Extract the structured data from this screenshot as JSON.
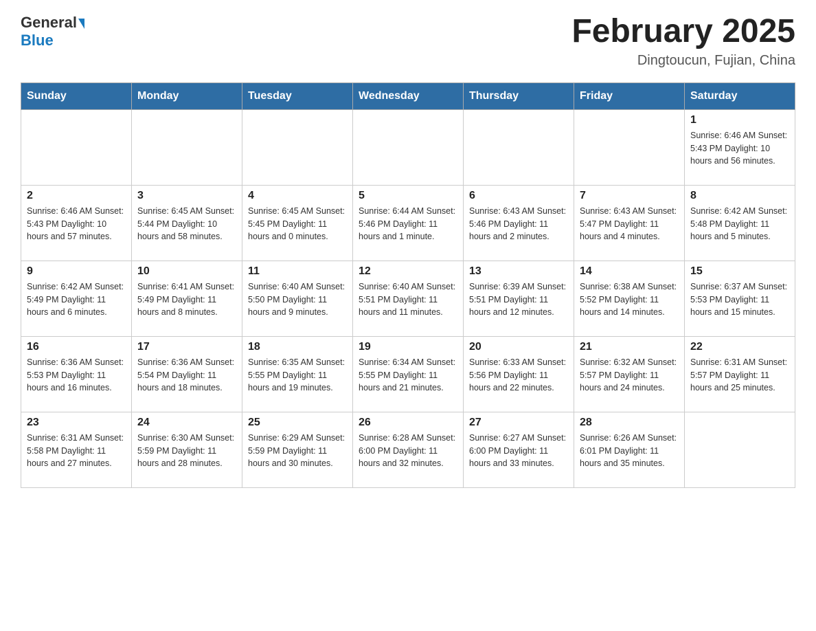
{
  "header": {
    "logo_general": "General",
    "logo_blue": "Blue",
    "month_title": "February 2025",
    "location": "Dingtoucun, Fujian, China"
  },
  "weekdays": [
    "Sunday",
    "Monday",
    "Tuesday",
    "Wednesday",
    "Thursday",
    "Friday",
    "Saturday"
  ],
  "weeks": [
    {
      "days": [
        {
          "number": "",
          "info": ""
        },
        {
          "number": "",
          "info": ""
        },
        {
          "number": "",
          "info": ""
        },
        {
          "number": "",
          "info": ""
        },
        {
          "number": "",
          "info": ""
        },
        {
          "number": "",
          "info": ""
        },
        {
          "number": "1",
          "info": "Sunrise: 6:46 AM\nSunset: 5:43 PM\nDaylight: 10 hours\nand 56 minutes."
        }
      ]
    },
    {
      "days": [
        {
          "number": "2",
          "info": "Sunrise: 6:46 AM\nSunset: 5:43 PM\nDaylight: 10 hours\nand 57 minutes."
        },
        {
          "number": "3",
          "info": "Sunrise: 6:45 AM\nSunset: 5:44 PM\nDaylight: 10 hours\nand 58 minutes."
        },
        {
          "number": "4",
          "info": "Sunrise: 6:45 AM\nSunset: 5:45 PM\nDaylight: 11 hours\nand 0 minutes."
        },
        {
          "number": "5",
          "info": "Sunrise: 6:44 AM\nSunset: 5:46 PM\nDaylight: 11 hours\nand 1 minute."
        },
        {
          "number": "6",
          "info": "Sunrise: 6:43 AM\nSunset: 5:46 PM\nDaylight: 11 hours\nand 2 minutes."
        },
        {
          "number": "7",
          "info": "Sunrise: 6:43 AM\nSunset: 5:47 PM\nDaylight: 11 hours\nand 4 minutes."
        },
        {
          "number": "8",
          "info": "Sunrise: 6:42 AM\nSunset: 5:48 PM\nDaylight: 11 hours\nand 5 minutes."
        }
      ]
    },
    {
      "days": [
        {
          "number": "9",
          "info": "Sunrise: 6:42 AM\nSunset: 5:49 PM\nDaylight: 11 hours\nand 6 minutes."
        },
        {
          "number": "10",
          "info": "Sunrise: 6:41 AM\nSunset: 5:49 PM\nDaylight: 11 hours\nand 8 minutes."
        },
        {
          "number": "11",
          "info": "Sunrise: 6:40 AM\nSunset: 5:50 PM\nDaylight: 11 hours\nand 9 minutes."
        },
        {
          "number": "12",
          "info": "Sunrise: 6:40 AM\nSunset: 5:51 PM\nDaylight: 11 hours\nand 11 minutes."
        },
        {
          "number": "13",
          "info": "Sunrise: 6:39 AM\nSunset: 5:51 PM\nDaylight: 11 hours\nand 12 minutes."
        },
        {
          "number": "14",
          "info": "Sunrise: 6:38 AM\nSunset: 5:52 PM\nDaylight: 11 hours\nand 14 minutes."
        },
        {
          "number": "15",
          "info": "Sunrise: 6:37 AM\nSunset: 5:53 PM\nDaylight: 11 hours\nand 15 minutes."
        }
      ]
    },
    {
      "days": [
        {
          "number": "16",
          "info": "Sunrise: 6:36 AM\nSunset: 5:53 PM\nDaylight: 11 hours\nand 16 minutes."
        },
        {
          "number": "17",
          "info": "Sunrise: 6:36 AM\nSunset: 5:54 PM\nDaylight: 11 hours\nand 18 minutes."
        },
        {
          "number": "18",
          "info": "Sunrise: 6:35 AM\nSunset: 5:55 PM\nDaylight: 11 hours\nand 19 minutes."
        },
        {
          "number": "19",
          "info": "Sunrise: 6:34 AM\nSunset: 5:55 PM\nDaylight: 11 hours\nand 21 minutes."
        },
        {
          "number": "20",
          "info": "Sunrise: 6:33 AM\nSunset: 5:56 PM\nDaylight: 11 hours\nand 22 minutes."
        },
        {
          "number": "21",
          "info": "Sunrise: 6:32 AM\nSunset: 5:57 PM\nDaylight: 11 hours\nand 24 minutes."
        },
        {
          "number": "22",
          "info": "Sunrise: 6:31 AM\nSunset: 5:57 PM\nDaylight: 11 hours\nand 25 minutes."
        }
      ]
    },
    {
      "days": [
        {
          "number": "23",
          "info": "Sunrise: 6:31 AM\nSunset: 5:58 PM\nDaylight: 11 hours\nand 27 minutes."
        },
        {
          "number": "24",
          "info": "Sunrise: 6:30 AM\nSunset: 5:59 PM\nDaylight: 11 hours\nand 28 minutes."
        },
        {
          "number": "25",
          "info": "Sunrise: 6:29 AM\nSunset: 5:59 PM\nDaylight: 11 hours\nand 30 minutes."
        },
        {
          "number": "26",
          "info": "Sunrise: 6:28 AM\nSunset: 6:00 PM\nDaylight: 11 hours\nand 32 minutes."
        },
        {
          "number": "27",
          "info": "Sunrise: 6:27 AM\nSunset: 6:00 PM\nDaylight: 11 hours\nand 33 minutes."
        },
        {
          "number": "28",
          "info": "Sunrise: 6:26 AM\nSunset: 6:01 PM\nDaylight: 11 hours\nand 35 minutes."
        },
        {
          "number": "",
          "info": ""
        }
      ]
    }
  ]
}
